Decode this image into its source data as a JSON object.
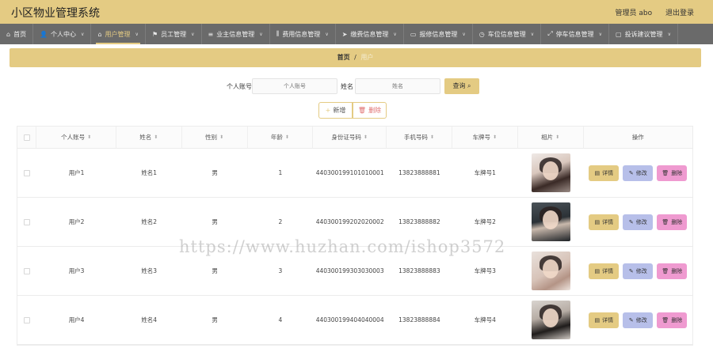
{
  "app": {
    "title": "小区物业管理系统",
    "user_label": "管理员 abo",
    "logout_label": "退出登录"
  },
  "nav": [
    {
      "label": "首页",
      "icon": "home-icon",
      "glyph": "⌂",
      "has_menu": false,
      "active": false
    },
    {
      "label": "个人中心",
      "icon": "user-icon",
      "glyph": "👤",
      "has_menu": true,
      "active": false
    },
    {
      "label": "用户管理",
      "icon": "bank-icon",
      "glyph": "⌂",
      "has_menu": true,
      "active": true
    },
    {
      "label": "员工管理",
      "icon": "flag-icon",
      "glyph": "⚑",
      "has_menu": true,
      "active": false
    },
    {
      "label": "业主信息管理",
      "icon": "menu-icon",
      "glyph": "≡",
      "has_menu": true,
      "active": false
    },
    {
      "label": "费用信息管理",
      "icon": "bar-icon",
      "glyph": "⫼",
      "has_menu": true,
      "active": false
    },
    {
      "label": "缴费信息管理",
      "icon": "send-icon",
      "glyph": "➤",
      "has_menu": true,
      "active": false
    },
    {
      "label": "报修信息管理",
      "icon": "folder-icon",
      "glyph": "▭",
      "has_menu": true,
      "active": false
    },
    {
      "label": "车位信息管理",
      "icon": "clock-icon",
      "glyph": "◷",
      "has_menu": true,
      "active": false
    },
    {
      "label": "停车信息管理",
      "icon": "expand-icon",
      "glyph": "⤢",
      "has_menu": true,
      "active": false
    },
    {
      "label": "投诉建议管理",
      "icon": "message-icon",
      "glyph": "▢",
      "has_menu": true,
      "active": false
    }
  ],
  "breadcrumb": {
    "home": "首页",
    "separator": "/",
    "current": "用户"
  },
  "search": {
    "account_label": "个人账号",
    "account_placeholder": "个人账号",
    "name_label": "姓名",
    "name_placeholder": "姓名",
    "search_button": "查询 ⌕"
  },
  "toolbar": {
    "add_label": "新增",
    "delete_label": "删除"
  },
  "table": {
    "columns": [
      "个人账号",
      "姓名",
      "性别",
      "年龄",
      "身份证号码",
      "手机号码",
      "车牌号",
      "相片",
      "操作"
    ],
    "rows": [
      {
        "account": "用户1",
        "name": "姓名1",
        "gender": "男",
        "age": "1",
        "id_card": "440300199101010001",
        "phone": "13823888881",
        "plate": "车牌号1"
      },
      {
        "account": "用户2",
        "name": "姓名2",
        "gender": "男",
        "age": "2",
        "id_card": "440300199202020002",
        "phone": "13823888882",
        "plate": "车牌号2"
      },
      {
        "account": "用户3",
        "name": "姓名3",
        "gender": "男",
        "age": "3",
        "id_card": "440300199303030003",
        "phone": "13823888883",
        "plate": "车牌号3"
      },
      {
        "account": "用户4",
        "name": "姓名4",
        "gender": "男",
        "age": "4",
        "id_card": "440300199404040004",
        "phone": "13823888884",
        "plate": "车牌号4"
      }
    ],
    "row_actions": {
      "detail": "详情",
      "edit": "修改",
      "delete": "删除"
    }
  },
  "watermark": "https://www.huzhan.com/ishop3572",
  "colors": {
    "accent": "#e4cb83",
    "nav_bg": "#6a6a6a",
    "edit": "#b7bfe9",
    "delete": "#ef9ad0"
  }
}
